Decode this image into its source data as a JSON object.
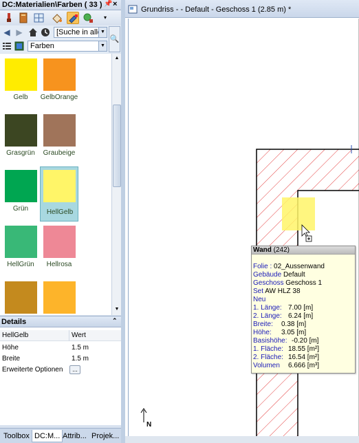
{
  "panel": {
    "title": "DC:Materialien\\Farben ( 33 )",
    "search_placeholder": "[Suche in allen I",
    "category": "Farben"
  },
  "swatches": [
    {
      "label": "Gelb",
      "color": "#FFEC00"
    },
    {
      "label": "GelbOrange",
      "color": "#F7931E"
    },
    {
      "label": "Grasgrün",
      "color": "#3C4622"
    },
    {
      "label": "Graubeige",
      "color": "#A0745A"
    },
    {
      "label": "Grün",
      "color": "#00A651"
    },
    {
      "label": "HellGelb",
      "color": "#FFF568",
      "selected": true
    },
    {
      "label": "HellGrün",
      "color": "#39B877"
    },
    {
      "label": "Hellrosa",
      "color": "#EE8896"
    },
    {
      "label": "",
      "color": "#C48A1E"
    },
    {
      "label": "",
      "color": "#FDB42A"
    }
  ],
  "details": {
    "title": "Details",
    "header_name": "HellGelb",
    "header_value": "Wert",
    "rows": [
      {
        "key": "Höhe",
        "value": "1.5 m"
      },
      {
        "key": "Breite",
        "value": "1.5 m"
      },
      {
        "key": "Erweiterte Optionen",
        "value": "..."
      }
    ]
  },
  "tabs": [
    "Toolbox",
    "DC:M...",
    "Attrib...",
    "Projek..."
  ],
  "document": {
    "title": "Grundriss - - Default - Geschoss 1 (2.85 m) *"
  },
  "tooltip": {
    "title": "Wand",
    "count": "(242)",
    "folie_key": "Folie :",
    "folie_val": "02_Aussenwand",
    "gebaeude_key": "Gebäude",
    "gebaeude_val": "Default",
    "geschoss_key": "Geschoss",
    "geschoss_val": "Geschoss 1",
    "set_key": "Set",
    "set_val": "AW HLZ 38",
    "neu": "Neu",
    "laenge1_key": "1. Länge:",
    "laenge1_val": "7.00 [m]",
    "laenge2_key": "2. Länge:",
    "laenge2_val": "6.24 [m]",
    "breite_key": "Breite:",
    "breite_val": "0.38 [m]",
    "hoehe_key": "Höhe:",
    "hoehe_val": "3.05 [m]",
    "basishoehe_key": "Basishöhe:",
    "basishoehe_val": "-0.20 [m]",
    "flaeche1_key": "1. Fläche:",
    "flaeche1_val": "18.55 [m²]",
    "flaeche2_key": "2. Fläche:",
    "flaeche2_val": "16.54 [m²]",
    "volumen_key": "Volumen",
    "volumen_val": "6.666 [m³]"
  },
  "north_label": "N",
  "colors": {
    "wall_hatch": "#e43d3d",
    "selection": "#FFF568",
    "link_blue": "#1a1ab8"
  }
}
